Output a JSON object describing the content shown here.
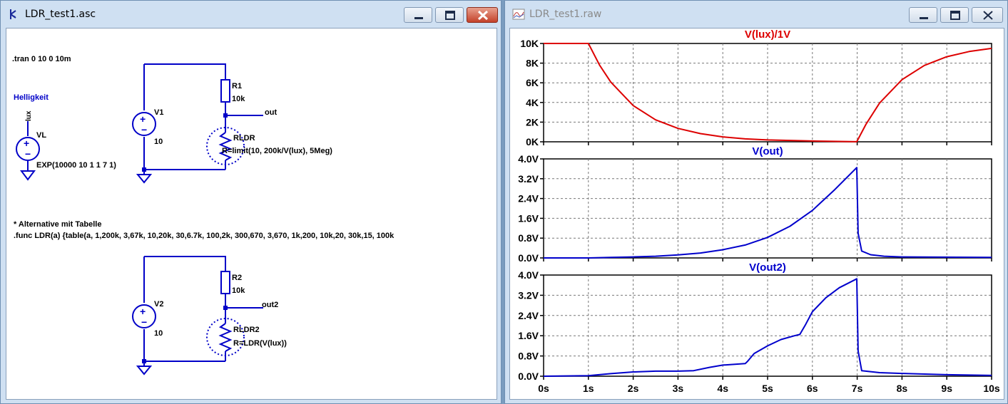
{
  "schematic_window": {
    "title": "LDR_test1.asc",
    "directive_tran": ".tran 0 10 0 10m",
    "label_helligkeit": "Helligkeit",
    "label_lux": "lux",
    "vl_name": "VL",
    "vl_value": "EXP(10000 10 1 1 7 1)",
    "v1_name": "V1",
    "v1_value": "10",
    "r1_name": "R1",
    "r1_value": "10k",
    "out_label": "out",
    "rldr_name": "RLDR",
    "rldr_value": "R=limit(10, 200k/V(lux), 5Meg)",
    "comment": "* Alternative mit Tabelle",
    "func_line": ".func LDR(a)  {table(a, 1,200k, 3,67k, 10,20k, 30,6.7k, 100,2k, 300,670, 3,670, 1k,200, 10k,20, 30k,15, 100k",
    "v2_name": "V2",
    "v2_value": "10",
    "r2_name": "R2",
    "r2_value": "10k",
    "out2_label": "out2",
    "rldr2_name": "RLDR2",
    "rldr2_value": "R=LDR(V(lux))"
  },
  "waveform_window": {
    "title": "LDR_test1.raw"
  },
  "colors": {
    "wire": "#0000c8",
    "trace_red": "#dd0000",
    "trace_blue": "#0000cc",
    "title_red": "#dd0000",
    "title_blue": "#0000cc"
  },
  "chart_data": [
    {
      "type": "line",
      "title": "V(lux)/1V",
      "y_ticks": [
        "10K",
        "8K",
        "6K",
        "4K",
        "2K",
        "0K"
      ],
      "ylim": [
        0,
        10000
      ],
      "xlim": [
        0,
        10
      ],
      "grid": true,
      "series": [
        {
          "color": "#dd0000",
          "x": [
            0,
            1,
            1.25,
            1.5,
            2,
            2.5,
            3,
            3.5,
            4,
            4.5,
            5,
            6,
            6.99,
            7.2,
            7.5,
            8,
            8.5,
            9,
            9.5,
            10
          ],
          "y": [
            10000,
            10000,
            7800,
            6070,
            3680,
            2230,
            1360,
            830,
            500,
            300,
            190,
            80,
            10,
            1820,
            3940,
            6320,
            7770,
            8650,
            9180,
            9500
          ]
        }
      ]
    },
    {
      "type": "line",
      "title": "V(out)",
      "y_ticks": [
        "4.0V",
        "3.2V",
        "2.4V",
        "1.6V",
        "0.8V",
        "0.0V"
      ],
      "ylim": [
        0,
        4.0
      ],
      "xlim": [
        0,
        10
      ],
      "grid": true,
      "series": [
        {
          "color": "#0000cc",
          "x": [
            0,
            1,
            1.5,
            2,
            2.5,
            3,
            3.5,
            4,
            4.5,
            5,
            5.5,
            6,
            6.5,
            6.99,
            7.02,
            7.1,
            7.3,
            7.6,
            8,
            10
          ],
          "y": [
            0.0,
            0.0,
            0.02,
            0.04,
            0.07,
            0.12,
            0.2,
            0.33,
            0.52,
            0.83,
            1.28,
            1.92,
            2.76,
            3.65,
            1.0,
            0.28,
            0.13,
            0.07,
            0.04,
            0.02
          ]
        }
      ]
    },
    {
      "type": "line",
      "title": "V(out2)",
      "y_ticks": [
        "4.0V",
        "3.2V",
        "2.4V",
        "1.6V",
        "0.8V",
        "0.0V"
      ],
      "x_ticks": [
        "0s",
        "1s",
        "2s",
        "3s",
        "4s",
        "5s",
        "6s",
        "7s",
        "8s",
        "9s",
        "10s"
      ],
      "ylim": [
        0,
        4.0
      ],
      "xlim": [
        0,
        10
      ],
      "grid": true,
      "series": [
        {
          "color": "#0000cc",
          "x": [
            0,
            1,
            1.5,
            2,
            2.5,
            3,
            3.35,
            3.7,
            4,
            4.5,
            4.55,
            4.7,
            5,
            5.3,
            5.6,
            5.72,
            5.85,
            6,
            6.3,
            6.6,
            6.99,
            7.02,
            7.1,
            7.5,
            8,
            9,
            10
          ],
          "y": [
            0.0,
            0.02,
            0.1,
            0.17,
            0.2,
            0.2,
            0.22,
            0.35,
            0.44,
            0.5,
            0.58,
            0.9,
            1.2,
            1.45,
            1.6,
            1.65,
            2.05,
            2.55,
            3.1,
            3.5,
            3.85,
            1.0,
            0.22,
            0.14,
            0.11,
            0.06,
            0.03
          ]
        }
      ]
    }
  ]
}
